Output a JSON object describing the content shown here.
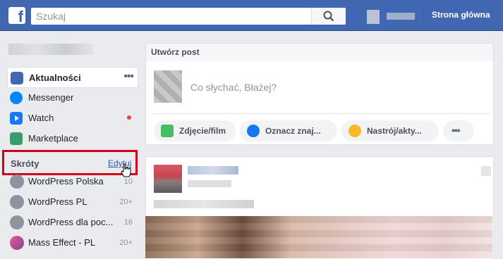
{
  "header": {
    "search_placeholder": "Szukaj",
    "home_label": "Strona główna"
  },
  "sidebar": {
    "items": [
      {
        "label": "Aktualności",
        "icon": "news-feed-icon",
        "color": "#4267b2"
      },
      {
        "label": "Messenger",
        "icon": "messenger-icon",
        "color": "#0084ff"
      },
      {
        "label": "Watch",
        "icon": "watch-icon",
        "color": "#1877f2"
      },
      {
        "label": "Marketplace",
        "icon": "marketplace-icon",
        "color": "#3a9b6b"
      }
    ],
    "shortcuts_title": "Skróty",
    "edit_label": "Edytuj",
    "shortcuts": [
      {
        "label": "WordPress Polska",
        "count": "10"
      },
      {
        "label": "WordPress PL",
        "count": "20+"
      },
      {
        "label": "WordPress dla poc...",
        "count": "16"
      },
      {
        "label": "Mass Effect - PL",
        "count": "20+"
      }
    ]
  },
  "composer": {
    "title": "Utwórz post",
    "placeholder": "Co słychać, Błażej?",
    "actions": [
      {
        "label": "Zdjęcie/film",
        "icon": "photo-icon"
      },
      {
        "label": "Oznacz znaj...",
        "icon": "tag-friends-icon"
      },
      {
        "label": "Nastrój/akty...",
        "icon": "feeling-icon"
      }
    ]
  },
  "colors": {
    "brand": "#4267b2",
    "highlight_box": "#d0021b"
  }
}
